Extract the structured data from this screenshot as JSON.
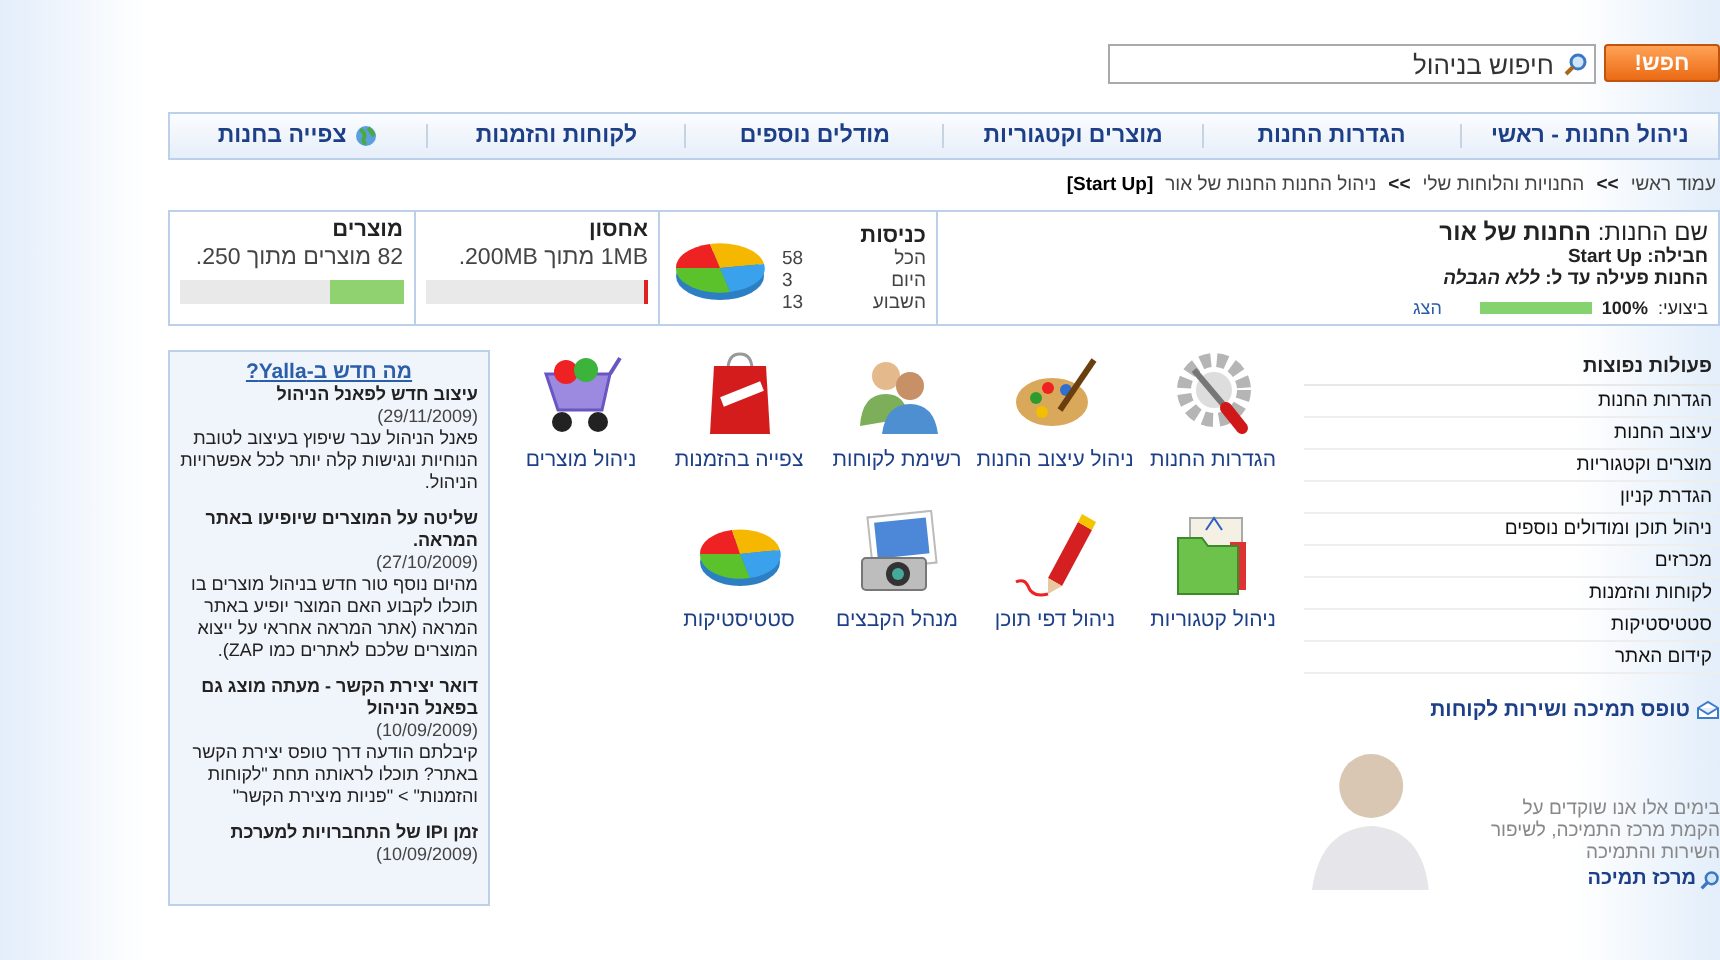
{
  "search": {
    "placeholder": "חיפוש בניהול",
    "button": "חפש!"
  },
  "nav": [
    {
      "label": "ניהול החנות - ראשי",
      "icon": false
    },
    {
      "label": "הגדרות החנות",
      "icon": false
    },
    {
      "label": "מוצרים וקטגוריות",
      "icon": false
    },
    {
      "label": "מודלים נוספים",
      "icon": false
    },
    {
      "label": "לקוחות והזמנות",
      "icon": false
    },
    {
      "label": "צפייה בחנות",
      "icon": true
    }
  ],
  "breadcrumb": [
    {
      "text": "עמוד ראשי",
      "kind": "link"
    },
    {
      "text": ">>",
      "kind": "sep"
    },
    {
      "text": "החנויות והלוחות שלי",
      "kind": "link"
    },
    {
      "text": ">>",
      "kind": "sep"
    },
    {
      "text": "ניהול החנות החנות של אור",
      "kind": "link"
    },
    {
      "text": "[Start Up]",
      "kind": "tag"
    }
  ],
  "store": {
    "name_label": "שם החנות:",
    "name": "החנות של אור",
    "package_label": "חבילה:",
    "package": "Start Up",
    "active_label": "החנות פעילה עד ל:",
    "active": "ללא הגבלה",
    "perf_label": "ביצועי:",
    "perf": "100%",
    "level": 1.0,
    "show_link": "הצג"
  },
  "visits": {
    "title": "כניסות",
    "rows": [
      {
        "label": "הכל",
        "value": "58"
      },
      {
        "label": "היום",
        "value": "3"
      },
      {
        "label": "השבוע",
        "value": "13"
      }
    ]
  },
  "storage": {
    "title": "אחסון",
    "text": "1MB מתוך 200MB.",
    "level": 0.01
  },
  "products": {
    "title": "מוצרים",
    "text": "82 מוצרים מתוך 250.",
    "level": 0.33
  },
  "sidebar": {
    "title": "פעולות נפוצות",
    "items": [
      "הגדרות החנות",
      "עיצוב החנות",
      "מוצרים וקטגוריות",
      "הגדרת קניון",
      "ניהול תוכן ומודולים נוספים",
      "מכרזים",
      "לקוחות והזמנות",
      "סטטיסטיקות",
      "קידום האתר"
    ]
  },
  "support": {
    "title": "טופס תמיכה ושירות לקוחות",
    "text": "בימים אלו אנו שוקדים על הקמת מרכז התמיכה, לשיפור השירות והתמיכה",
    "link": "מרכז תמיכה"
  },
  "tools": [
    {
      "label": "הגדרות החנות",
      "kind": "gear"
    },
    {
      "label": "ניהול עיצוב החנות",
      "kind": "palette"
    },
    {
      "label": "רשימת לקוחות",
      "kind": "people"
    },
    {
      "label": "צפייה בהזמנות",
      "kind": "bag"
    },
    {
      "label": "ניהול מוצרים",
      "kind": "cart"
    },
    {
      "label": "ניהול קטגוריות",
      "kind": "folder"
    },
    {
      "label": "ניהול דפי תוכן",
      "kind": "pencil"
    },
    {
      "label": "מנהל הקבצים",
      "kind": "camera"
    },
    {
      "label": "סטטיסטיקות",
      "kind": "pie"
    }
  ],
  "news": {
    "title": "מה חדש ב-Yalla?",
    "items": [
      {
        "title": "עיצוב חדש לפאנל הניהול",
        "date": "(29/11/2009)",
        "body": "פאנל הניהול עבר שיפוץ בעיצוב לטובת הנוחיות ונגישות קלה יותר לכל אפשרויות הניהול."
      },
      {
        "title": "שליטה על המוצרים שיופיעו באתר המראה.",
        "date": "(27/10/2009)",
        "body": "מהיום נוסף טור חדש בניהול מוצרים בו תוכלו לקבוע האם המוצר יופיע באתר המראה (אתר המראה אחראי על ייצוא המוצרים שלכם לאתרים כמו ZAP)."
      },
      {
        "title": "דואר יצירת הקשר - מעתה מוצג גם בפאנל הניהול",
        "date": "(10/09/2009)",
        "body": "קיבלתם הודעה דרך טופס יצירת הקשר באתר? תוכלו לראותה תחת \"לקוחות והזמנות\" > \"פניות מיצירת הקשר\""
      },
      {
        "title": "זמן וIP של התחברויות למערכת",
        "date": "(10/09/2009)"
      }
    ]
  }
}
